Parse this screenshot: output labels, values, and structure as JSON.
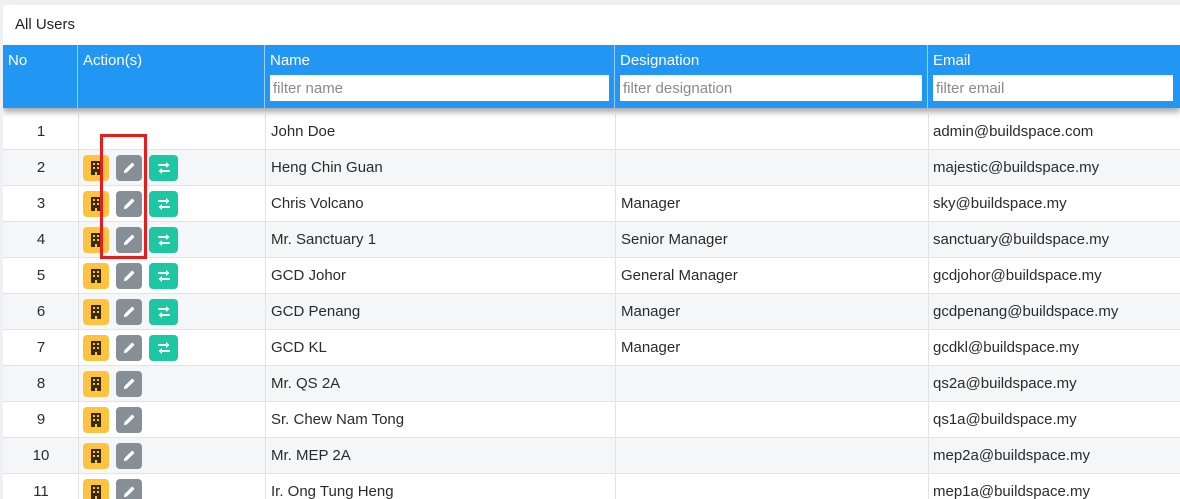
{
  "panel": {
    "title": "All Users"
  },
  "columns": {
    "no": "No",
    "actions": "Action(s)",
    "name": "Name",
    "designation": "Designation",
    "email": "Email"
  },
  "filters": {
    "name_placeholder": "filter name",
    "designation_placeholder": "filter designation",
    "email_placeholder": "filter email"
  },
  "icons": {
    "building": "building-icon",
    "edit": "pencil-icon",
    "switch": "switch-arrows-icon"
  },
  "colors": {
    "header": "#2196f3",
    "building_button": "#fdc23e",
    "edit_button": "#868e96",
    "switch_button": "#1ec7a4",
    "highlight": "#e41e1e"
  },
  "rows": [
    {
      "no": "1",
      "name": "John Doe",
      "designation": "",
      "email": "admin@buildspace.com",
      "building": false,
      "edit": false,
      "switch": false
    },
    {
      "no": "2",
      "name": "Heng Chin Guan",
      "designation": "",
      "email": "majestic@buildspace.my",
      "building": true,
      "edit": true,
      "switch": true
    },
    {
      "no": "3",
      "name": "Chris Volcano",
      "designation": "Manager",
      "email": "sky@buildspace.my",
      "building": true,
      "edit": true,
      "switch": true
    },
    {
      "no": "4",
      "name": "Mr. Sanctuary 1",
      "designation": "Senior Manager",
      "email": "sanctuary@buildspace.my",
      "building": true,
      "edit": true,
      "switch": true
    },
    {
      "no": "5",
      "name": "GCD Johor",
      "designation": "General Manager",
      "email": "gcdjohor@buildspace.my",
      "building": true,
      "edit": true,
      "switch": true
    },
    {
      "no": "6",
      "name": "GCD Penang",
      "designation": "Manager",
      "email": "gcdpenang@buildspace.my",
      "building": true,
      "edit": true,
      "switch": true
    },
    {
      "no": "7",
      "name": "GCD KL",
      "designation": "Manager",
      "email": "gcdkl@buildspace.my",
      "building": true,
      "edit": true,
      "switch": true
    },
    {
      "no": "8",
      "name": "Mr. QS 2A",
      "designation": "",
      "email": "qs2a@buildspace.my",
      "building": true,
      "edit": true,
      "switch": false
    },
    {
      "no": "9",
      "name": "Sr. Chew Nam Tong",
      "designation": "",
      "email": "qs1a@buildspace.my",
      "building": true,
      "edit": true,
      "switch": false
    },
    {
      "no": "10",
      "name": "Mr. MEP 2A",
      "designation": "",
      "email": "mep2a@buildspace.my",
      "building": true,
      "edit": true,
      "switch": false
    },
    {
      "no": "11",
      "name": "Ir. Ong Tung Heng",
      "designation": "",
      "email": "mep1a@buildspace.my",
      "building": true,
      "edit": true,
      "switch": false
    }
  ]
}
